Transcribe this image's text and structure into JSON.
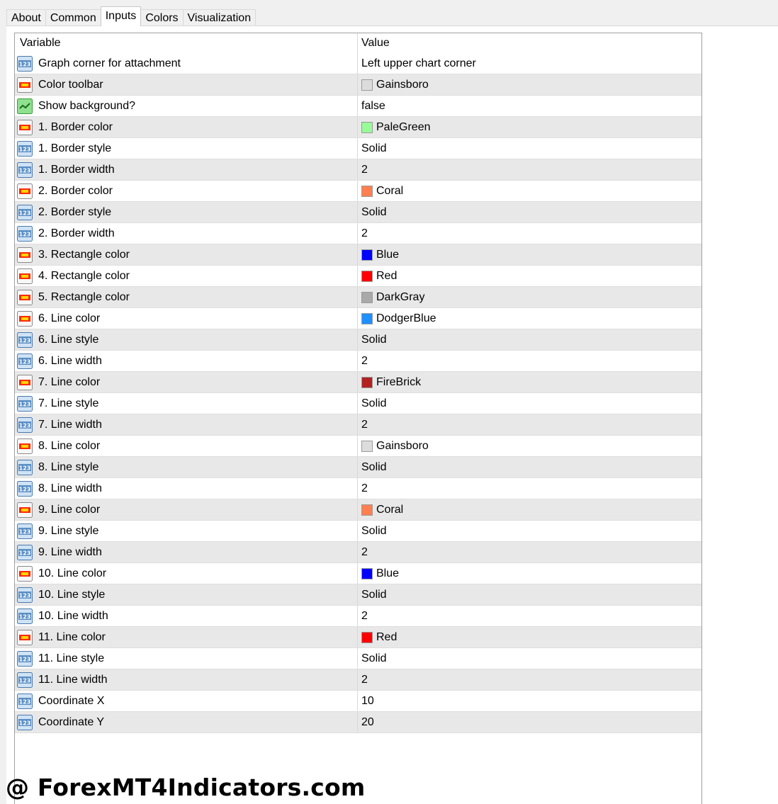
{
  "tabs": [
    "About",
    "Common",
    "Inputs",
    "Colors",
    "Visualization"
  ],
  "active_tab": "Inputs",
  "grid": {
    "header": {
      "variable": "Variable",
      "value": "Value"
    },
    "rows": [
      {
        "type": "number",
        "name": "Graph corner for attachment",
        "value": "Left upper chart corner"
      },
      {
        "type": "color",
        "name": "Color toolbar",
        "value": "Gainsboro",
        "color": "#dcdcdc"
      },
      {
        "type": "bool",
        "name": "Show background?",
        "value": "false"
      },
      {
        "type": "color",
        "name": "1. Border color",
        "value": "PaleGreen",
        "color": "#98fb98"
      },
      {
        "type": "number",
        "name": "1. Border style",
        "value": "Solid"
      },
      {
        "type": "number",
        "name": "1. Border width",
        "value": "2"
      },
      {
        "type": "color",
        "name": "2. Border color",
        "value": "Coral",
        "color": "#ff7f50"
      },
      {
        "type": "number",
        "name": "2. Border style",
        "value": "Solid"
      },
      {
        "type": "number",
        "name": "2. Border width",
        "value": "2"
      },
      {
        "type": "color",
        "name": "3. Rectangle color",
        "value": "Blue",
        "color": "#0000ff"
      },
      {
        "type": "color",
        "name": "4. Rectangle color",
        "value": "Red",
        "color": "#ff0000"
      },
      {
        "type": "color",
        "name": "5. Rectangle color",
        "value": "DarkGray",
        "color": "#a9a9a9"
      },
      {
        "type": "color",
        "name": "6. Line color",
        "value": "DodgerBlue",
        "color": "#1e90ff"
      },
      {
        "type": "number",
        "name": "6. Line style",
        "value": "Solid"
      },
      {
        "type": "number",
        "name": "6. Line width",
        "value": "2"
      },
      {
        "type": "color",
        "name": "7. Line color",
        "value": "FireBrick",
        "color": "#b22222"
      },
      {
        "type": "number",
        "name": "7. Line style",
        "value": "Solid"
      },
      {
        "type": "number",
        "name": "7. Line width",
        "value": "2"
      },
      {
        "type": "color",
        "name": "8. Line color",
        "value": "Gainsboro",
        "color": "#dcdcdc"
      },
      {
        "type": "number",
        "name": "8. Line style",
        "value": "Solid"
      },
      {
        "type": "number",
        "name": "8. Line width",
        "value": "2"
      },
      {
        "type": "color",
        "name": "9. Line color",
        "value": "Coral",
        "color": "#ff7f50"
      },
      {
        "type": "number",
        "name": "9. Line style",
        "value": "Solid"
      },
      {
        "type": "number",
        "name": "9. Line width",
        "value": "2"
      },
      {
        "type": "color",
        "name": "10. Line color",
        "value": "Blue",
        "color": "#0000ff"
      },
      {
        "type": "number",
        "name": "10. Line style",
        "value": "Solid"
      },
      {
        "type": "number",
        "name": "10. Line width",
        "value": "2"
      },
      {
        "type": "color",
        "name": "11. Line color",
        "value": "Red",
        "color": "#ff0000"
      },
      {
        "type": "number",
        "name": "11. Line style",
        "value": "Solid"
      },
      {
        "type": "number",
        "name": "11. Line width",
        "value": "2"
      },
      {
        "type": "number",
        "name": "Coordinate X",
        "value": "10"
      },
      {
        "type": "number",
        "name": "Coordinate Y",
        "value": "20"
      }
    ]
  },
  "icons": {
    "number": "numeric-123-icon",
    "color": "color-palette-icon",
    "bool": "boolean-checkmark-icon"
  },
  "watermark": "@ ForexMT4Indicators.com"
}
